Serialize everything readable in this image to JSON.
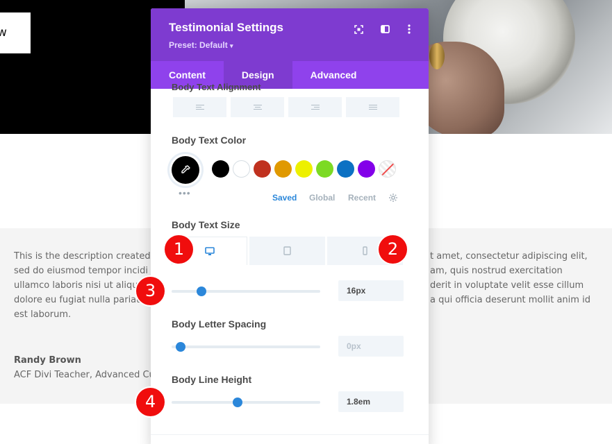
{
  "background": {
    "hero_button_text": "w",
    "testimonial": {
      "left_lines": [
        "This is the description created",
        "sed do eiusmod tempor incidi",
        "ullamco laboris nisi ut aliqu",
        "dolore eu fugiat nulla pariat",
        "est laborum."
      ],
      "right_lines": [
        "t amet, consectetur adipiscing elit,",
        "am, quis nostrud exercitation",
        "derit in voluptate velit esse cillum",
        "a qui officia deserunt mollit anim id"
      ],
      "author_name": "Randy Brown",
      "author_role": "ACF Divi Teacher, Advanced Cu"
    }
  },
  "panel": {
    "title": "Testimonial Settings",
    "preset": "Preset: Default",
    "tabs": [
      "Content",
      "Design",
      "Advanced"
    ],
    "active_tab": "Design",
    "cut_label": "Body Text Alignment",
    "body_text_color": {
      "label": "Body Text Color",
      "selected": "#000000",
      "swatches": [
        "#000000",
        "#ffffff",
        "#c0311f",
        "#e09900",
        "#edf000",
        "#7cda24",
        "#0c71c3",
        "#8300e9",
        "none"
      ],
      "tabs": [
        "Saved",
        "Global",
        "Recent"
      ],
      "active_tab": "Saved",
      "accent": "#2b87da"
    },
    "body_text_size": {
      "label": "Body Text Size",
      "devices": [
        "desktop",
        "tablet",
        "phone"
      ],
      "active_device": "desktop",
      "value": "16px",
      "slider_fraction": 0.17
    },
    "body_letter_spacing": {
      "label": "Body Letter Spacing",
      "value": "0px",
      "slider_fraction": 0.03
    },
    "body_line_height": {
      "label": "Body Line Height",
      "value": "1.8em",
      "slider_fraction": 0.41
    }
  },
  "badges": [
    "1",
    "2",
    "3",
    "4"
  ],
  "colors": {
    "header_purple": "#7e3bd0",
    "tabs_purple": "#8f42ec",
    "badge_red": "#f00d0d",
    "slider_blue": "#2b87da"
  }
}
